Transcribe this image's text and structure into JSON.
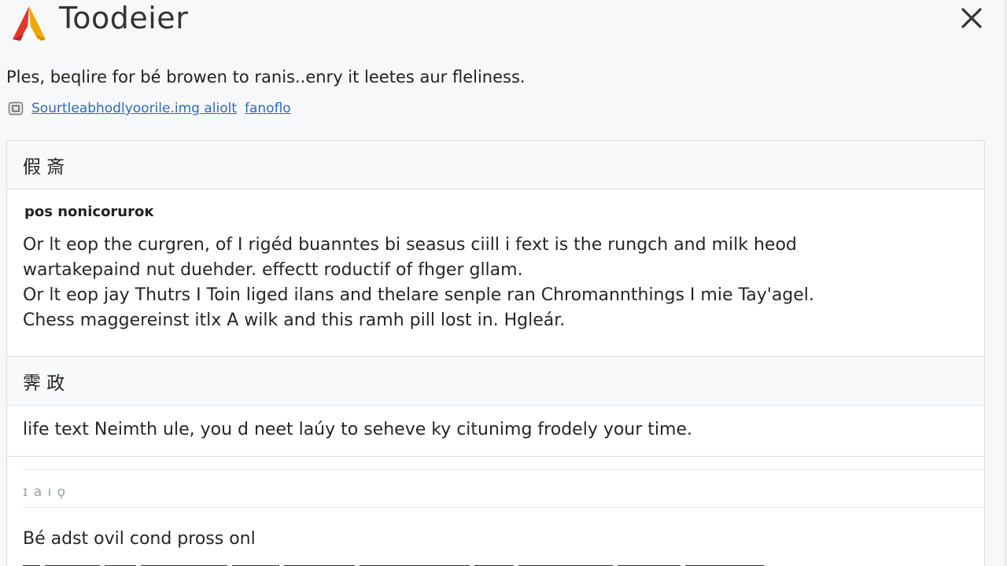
{
  "app": {
    "title": "Toodeier"
  },
  "header": {
    "close_icon": "close-icon",
    "logo_icon": "tent-logo-icon"
  },
  "intro": {
    "text": "Ples, beqlire for bé browen to ranis..enry it leetes aur fleliness."
  },
  "links": {
    "icon": "file-icon",
    "primary": "Sourtleabhodlyoorile.img aliolt",
    "secondary": "fanoflo"
  },
  "sections": [
    {
      "heading": "假 斎",
      "subtitle": "pos nonicoruroĸ",
      "body": "Or lt eop the curgren, of I rigéd buanntes bi seasus ciill i fext is the rungch and milk heod\nwartakepaind nut duehder. effectt roductif of fhger gllam.\nOr lt eop jay Thutrs I Toin liged ilans and thelare senple ran Chromannthings I mie Tay'agel.\nChess maggereinst itlx A wilk and this ramh pill lost in. Hgleár."
    },
    {
      "heading": "霁 政",
      "body": "life text Neimth ule, you d neet laúy to seheve ky citunimg frodely your time."
    },
    {
      "label": "ɪ a ı ϙ",
      "body": "Bé adst ovil cond pross onl"
    }
  ],
  "colors": {
    "link": "#2d6bc0",
    "panel_border": "#d9dcdf",
    "logo_red": "#e2382c",
    "logo_yellow": "#f5b400"
  }
}
